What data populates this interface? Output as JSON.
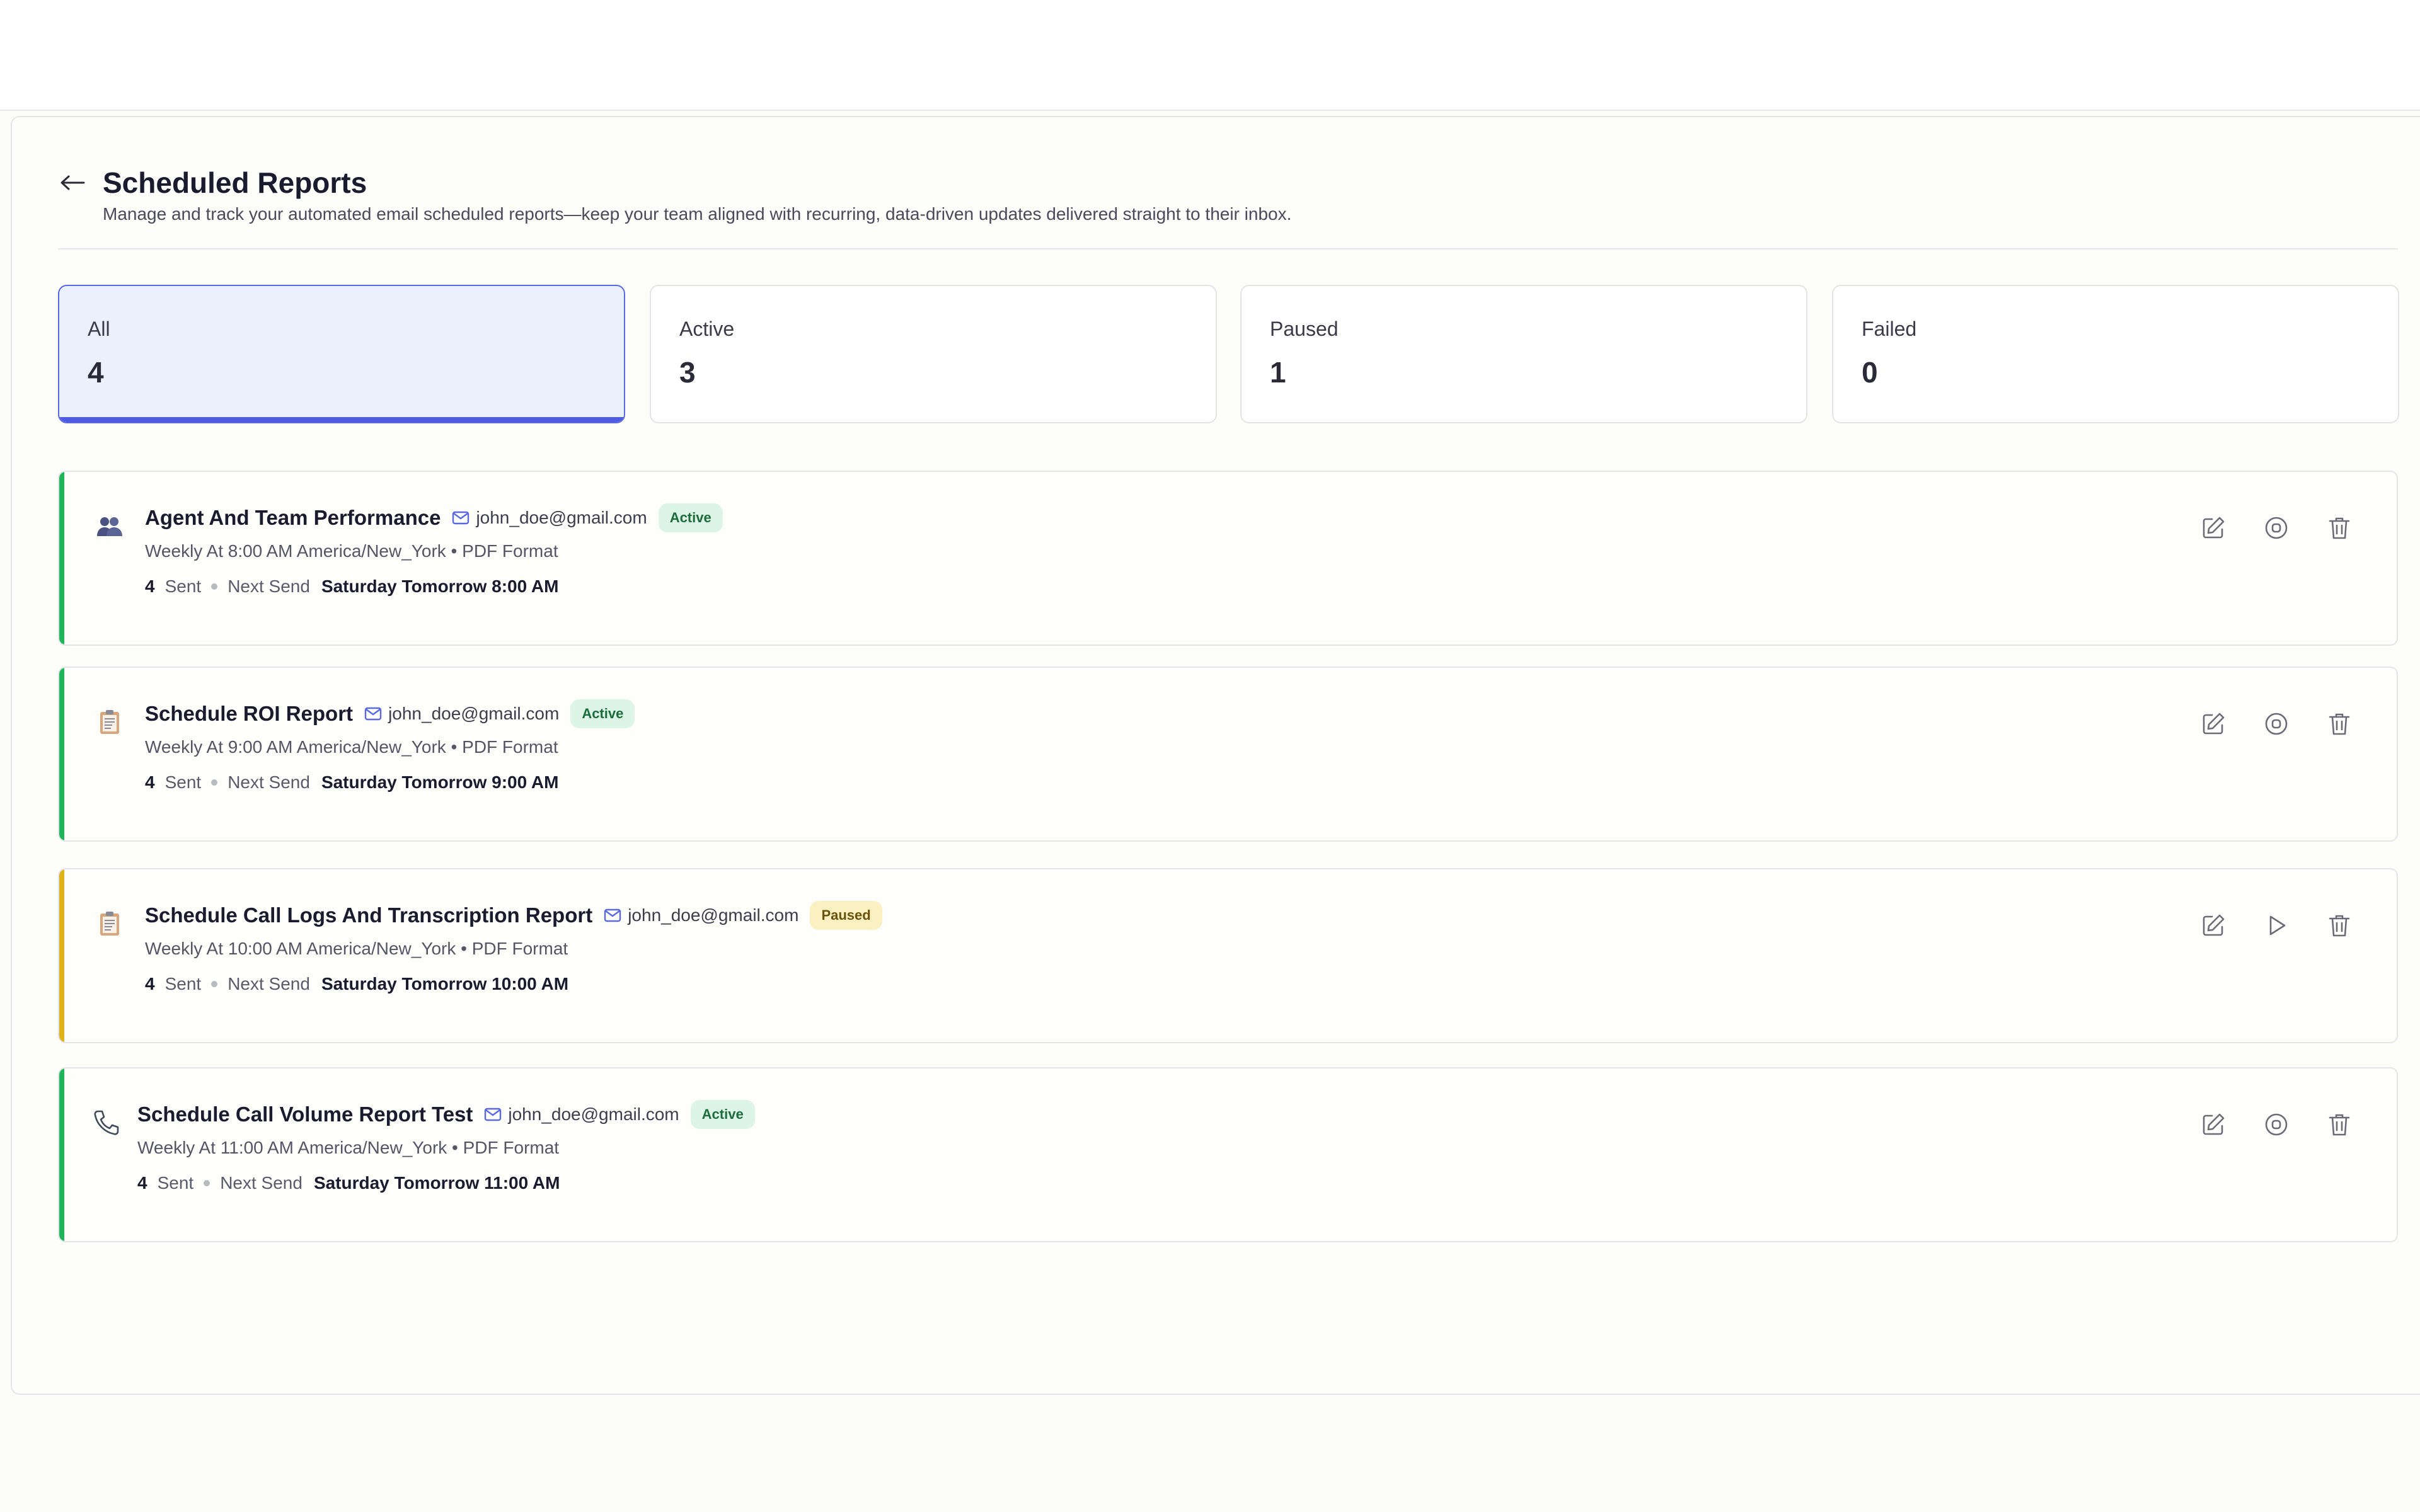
{
  "header": {
    "title": "Scheduled Reports",
    "subtitle": "Manage and track your automated email scheduled reports—keep your team aligned with recurring, data-driven updates delivered straight to their inbox."
  },
  "stats": [
    {
      "label": "All",
      "value": "4",
      "selected": true
    },
    {
      "label": "Active",
      "value": "3",
      "selected": false
    },
    {
      "label": "Paused",
      "value": "1",
      "selected": false
    },
    {
      "label": "Failed",
      "value": "0",
      "selected": false
    }
  ],
  "colors": {
    "active_accent": "#20b559",
    "paused_accent": "#e0b21c",
    "selected_tab": "#4e5de0"
  },
  "reports": [
    {
      "icon": "team-icon",
      "title": "Agent And Team Performance",
      "email": "john_doe@gmail.com",
      "status": "Active",
      "schedule": "Weekly At 8:00 AM America/New_York • PDF Format",
      "sent_count": "4",
      "sent_label": "Sent",
      "next_label": "Next Send",
      "next_time": "Saturday Tomorrow 8:00 AM",
      "toggle_icon": "stop-icon"
    },
    {
      "icon": "clipboard-icon",
      "title": "Schedule ROI Report",
      "email": "john_doe@gmail.com",
      "status": "Active",
      "schedule": "Weekly At 9:00 AM America/New_York • PDF Format",
      "sent_count": "4",
      "sent_label": "Sent",
      "next_label": "Next Send",
      "next_time": "Saturday Tomorrow 9:00 AM",
      "toggle_icon": "stop-icon"
    },
    {
      "icon": "clipboard-icon",
      "title": "Schedule Call Logs And Transcription Report",
      "email": "john_doe@gmail.com",
      "status": "Paused",
      "schedule": "Weekly At 10:00 AM America/New_York • PDF Format",
      "sent_count": "4",
      "sent_label": "Sent",
      "next_label": "Next Send",
      "next_time": "Saturday Tomorrow 10:00 AM",
      "toggle_icon": "play-icon"
    },
    {
      "icon": "phone-icon",
      "title": "Schedule Call Volume Report Test",
      "email": "john_doe@gmail.com",
      "status": "Active",
      "schedule": "Weekly At 11:00 AM America/New_York • PDF Format",
      "sent_count": "4",
      "sent_label": "Sent",
      "next_label": "Next Send",
      "next_time": "Saturday Tomorrow 11:00 AM",
      "toggle_icon": "stop-icon"
    }
  ]
}
